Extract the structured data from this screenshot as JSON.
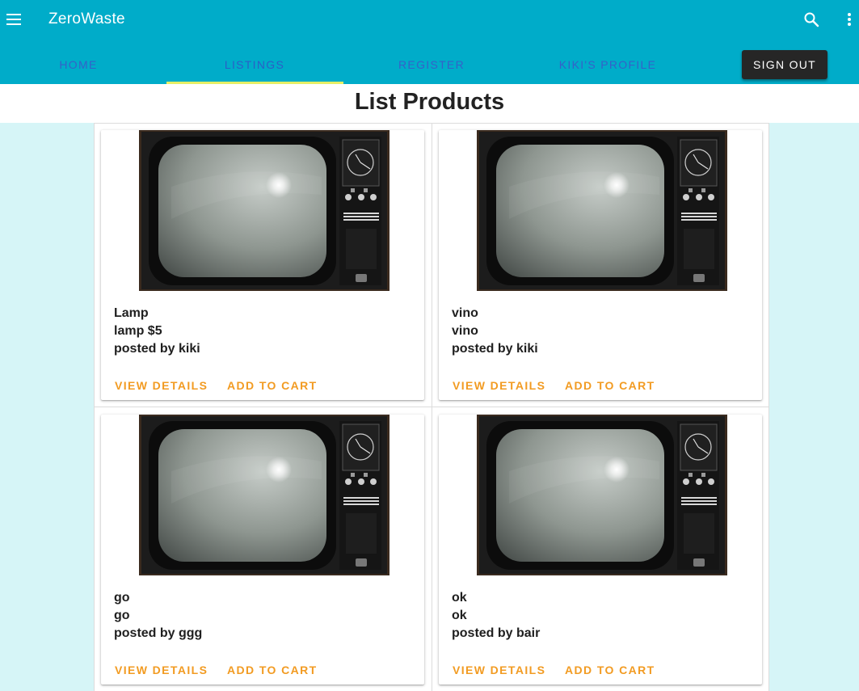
{
  "app": {
    "title": "ZeroWaste",
    "brand_color": "#00acc9",
    "accent_color": "#f29b22",
    "tab_text_color": "#3561c9",
    "tab_indicator_color": "#e6ee66"
  },
  "icons": {
    "menu": "menu-icon",
    "search": "search-icon",
    "more": "more-vert-icon"
  },
  "tabs": [
    {
      "label": "HOME",
      "active": false
    },
    {
      "label": "LISTINGS",
      "active": true
    },
    {
      "label": "REGISTER",
      "active": false
    },
    {
      "label": "KIKI'S PROFILE",
      "active": false
    }
  ],
  "signout_label": "SIGN OUT",
  "page": {
    "title": "List Products"
  },
  "products": [
    {
      "name": "Lamp",
      "description": "lamp $5",
      "posted_by": "posted by kiki",
      "image": "retro-tv-image"
    },
    {
      "name": "vino",
      "description": "vino",
      "posted_by": "posted by kiki",
      "image": "retro-tv-image"
    },
    {
      "name": "go",
      "description": "go",
      "posted_by": "posted by ggg",
      "image": "retro-tv-image"
    },
    {
      "name": "ok",
      "description": "ok",
      "posted_by": "posted by bair",
      "image": "retro-tv-image"
    }
  ],
  "card_actions": {
    "view_details": "VIEW DETAILS",
    "add_to_cart": "ADD TO CART"
  }
}
